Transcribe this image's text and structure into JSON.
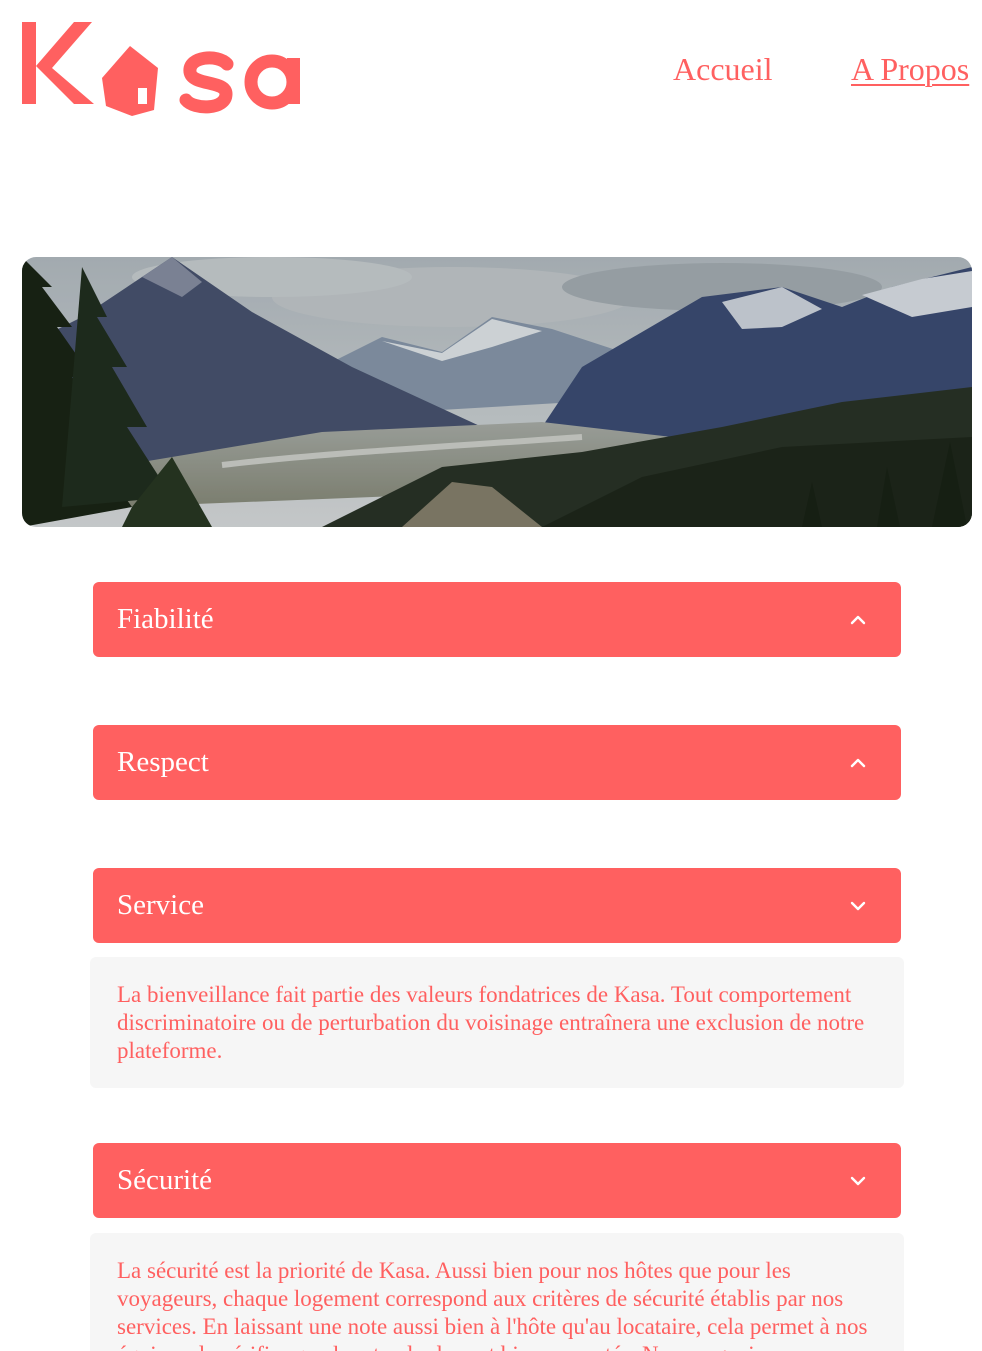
{
  "brand": {
    "name": "Kasa",
    "color": "#FF6060"
  },
  "nav": {
    "home_label": "Accueil",
    "about_label": "A Propos",
    "active": "about"
  },
  "banner": {
    "image": "mountain-landscape"
  },
  "collapses": [
    {
      "title": "Fiabilité",
      "state": "closed",
      "icon": "chevron-up-icon"
    },
    {
      "title": "Respect",
      "state": "closed",
      "icon": "chevron-up-icon"
    },
    {
      "title": "Service",
      "state": "open",
      "icon": "chevron-down-icon",
      "text": "La bienveillance fait partie des valeurs fondatrices de Kasa. Tout comportement discriminatoire ou de perturbation du voisinage entraînera une exclusion de notre plateforme."
    },
    {
      "title": "Sécurité",
      "state": "open",
      "icon": "chevron-down-icon",
      "text": "La sécurité est la priorité de Kasa. Aussi bien pour nos hôtes que pour les voyageurs, chaque logement correspond aux critères de sécurité établis par nos services. En laissant une note aussi bien à l'hôte qu'au locataire, cela permet à nos équipes de vérifier que les standards sont bien respectés. Nous organisons également des ateliers sur la sécurité domestique pour nos hôtes."
    }
  ],
  "colors": {
    "accent": "#FF6060",
    "panel": "#F6F6F6",
    "header_text": "#FFFFFF"
  }
}
